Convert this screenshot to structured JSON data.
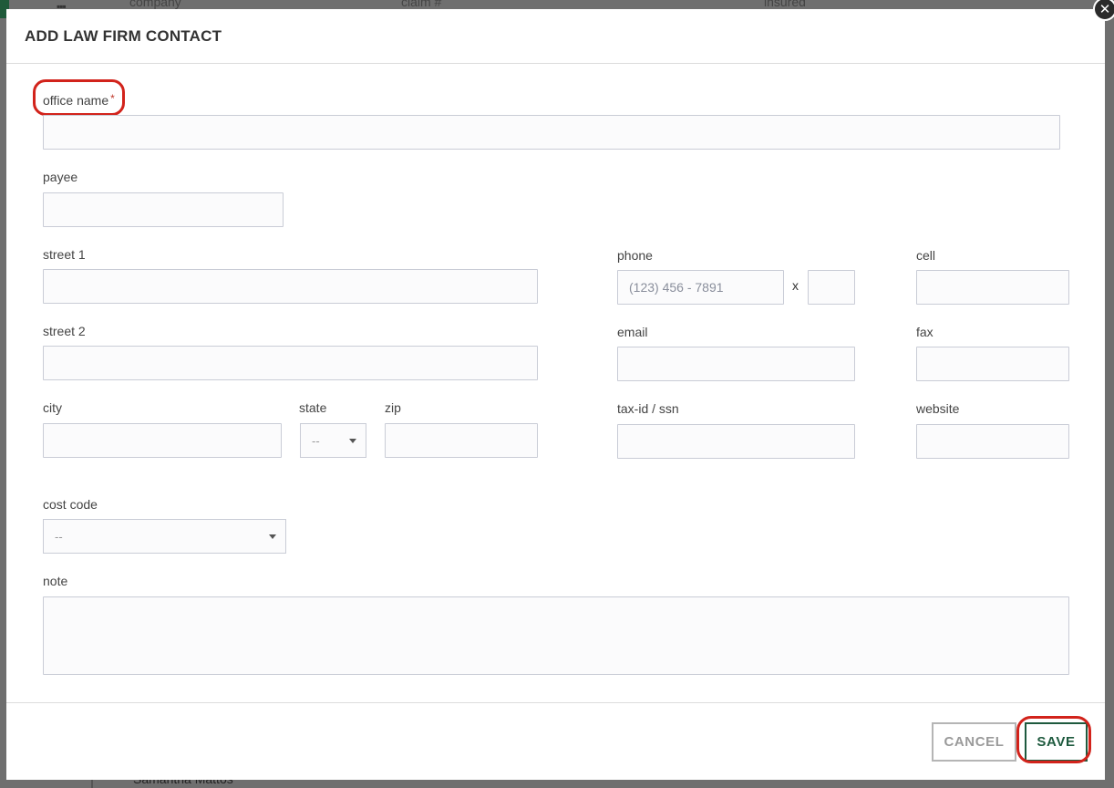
{
  "background": {
    "columns": [
      "company",
      "claim #",
      "insured"
    ],
    "footer_text": "Samantha Mattos"
  },
  "modal": {
    "title": "ADD LAW FIRM CONTACT",
    "close_glyph": "✕"
  },
  "fields": {
    "office_name": {
      "label": "office name",
      "required_mark": "*",
      "value": ""
    },
    "payee": {
      "label": "payee",
      "value": ""
    },
    "street1": {
      "label": "street 1",
      "value": ""
    },
    "street2": {
      "label": "street 2",
      "value": ""
    },
    "city": {
      "label": "city",
      "value": ""
    },
    "state": {
      "label": "state",
      "value": "--"
    },
    "zip": {
      "label": "zip",
      "value": ""
    },
    "phone": {
      "label": "phone",
      "placeholder": "(123) 456 - 7891",
      "value": "",
      "ext_separator": "x",
      "ext_value": ""
    },
    "cell": {
      "label": "cell",
      "value": ""
    },
    "email": {
      "label": "email",
      "value": ""
    },
    "fax": {
      "label": "fax",
      "value": ""
    },
    "tax_id": {
      "label": "tax-id / ssn",
      "value": ""
    },
    "website": {
      "label": "website",
      "value": ""
    },
    "cost_code": {
      "label": "cost code",
      "value": "--"
    },
    "note": {
      "label": "note",
      "value": ""
    }
  },
  "buttons": {
    "cancel": "CANCEL",
    "save": "SAVE"
  },
  "colors": {
    "required": "#c0392b",
    "highlight": "#d2231b",
    "save_accent": "#1e5a3e"
  }
}
